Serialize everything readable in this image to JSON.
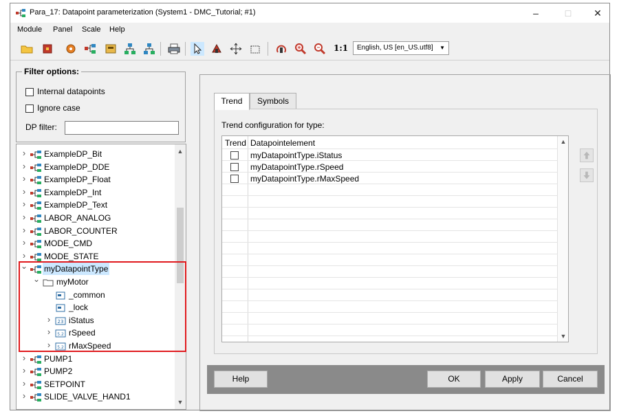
{
  "window": {
    "title": "Para_17: Datapoint parameterization (System1 - DMC_Tutorial; #1)",
    "controls": {
      "minimize": "–",
      "maximize": "□",
      "close": "✕"
    }
  },
  "menu": [
    "Module",
    "Panel",
    "Scale",
    "Help"
  ],
  "toolbar": {
    "icons": [
      "open-folder-icon",
      "stop-icon",
      "settings-icon",
      "datapoint-tree-icon",
      "archive-icon",
      "network-icon",
      "network-alt-icon",
      "print-icon",
      "pointer-icon",
      "zoom-pan-icon",
      "move-icon",
      "select-rect-icon",
      "rotate-icon",
      "zoom-in-icon",
      "zoom-out-icon"
    ],
    "scale_label": "1:1",
    "language": "English, US [en_US.utf8]"
  },
  "filter": {
    "legend": "Filter options:",
    "internal_datapoints": "Internal datapoints",
    "ignore_case": "Ignore case",
    "dp_filter_label": "DP filter:",
    "dp_filter_value": ""
  },
  "tree": {
    "items": [
      {
        "label": "ExampleDP_Bit",
        "level": 0,
        "expanded": false,
        "icon": "dpt-icon"
      },
      {
        "label": "ExampleDP_DDE",
        "level": 0,
        "expanded": false,
        "icon": "dpt-icon"
      },
      {
        "label": "ExampleDP_Float",
        "level": 0,
        "expanded": false,
        "icon": "dpt-icon"
      },
      {
        "label": "ExampleDP_Int",
        "level": 0,
        "expanded": false,
        "icon": "dpt-icon"
      },
      {
        "label": "ExampleDP_Text",
        "level": 0,
        "expanded": false,
        "icon": "dpt-icon"
      },
      {
        "label": "LABOR_ANALOG",
        "level": 0,
        "expanded": false,
        "icon": "dpt-icon"
      },
      {
        "label": "LABOR_COUNTER",
        "level": 0,
        "expanded": false,
        "icon": "dpt-icon"
      },
      {
        "label": "MODE_CMD",
        "level": 0,
        "expanded": false,
        "icon": "dpt-icon"
      },
      {
        "label": "MODE_STATE",
        "level": 0,
        "expanded": false,
        "icon": "dpt-icon"
      },
      {
        "label": "myDatapointType",
        "level": 0,
        "expanded": true,
        "icon": "dpt-icon",
        "selected": true
      },
      {
        "label": "myMotor",
        "level": 1,
        "expanded": true,
        "icon": "folder-icon"
      },
      {
        "label": "_common",
        "level": 2,
        "expanded": null,
        "icon": "config-icon"
      },
      {
        "label": "_lock",
        "level": 2,
        "expanded": null,
        "icon": "config-icon"
      },
      {
        "label": "iStatus",
        "level": 2,
        "expanded": false,
        "icon": "int-type-icon"
      },
      {
        "label": "rSpeed",
        "level": 2,
        "expanded": false,
        "icon": "float-type-icon"
      },
      {
        "label": "rMaxSpeed",
        "level": 2,
        "expanded": false,
        "icon": "float-type-icon"
      },
      {
        "label": "PUMP1",
        "level": 0,
        "expanded": false,
        "icon": "dpt-icon"
      },
      {
        "label": "PUMP2",
        "level": 0,
        "expanded": false,
        "icon": "dpt-icon"
      },
      {
        "label": "SETPOINT",
        "level": 0,
        "expanded": false,
        "icon": "dpt-icon"
      },
      {
        "label": "SLIDE_VALVE_HAND1",
        "level": 0,
        "expanded": false,
        "icon": "dpt-icon"
      }
    ],
    "type_badges": {
      "int": "23",
      "float": "5.2"
    }
  },
  "tabs": [
    {
      "label": "Trend",
      "active": true
    },
    {
      "label": "Symbols",
      "active": false
    }
  ],
  "trend": {
    "caption": "Trend configuration for type:",
    "columns": [
      "Trend",
      "Datapointelement"
    ],
    "rows": [
      {
        "checked": false,
        "element": "myDatapointType.iStatus"
      },
      {
        "checked": false,
        "element": "myDatapointType.rSpeed"
      },
      {
        "checked": false,
        "element": "myDatapointType.rMaxSpeed"
      }
    ]
  },
  "buttons": {
    "help": "Help",
    "ok": "OK",
    "apply": "Apply",
    "cancel": "Cancel"
  },
  "colors": {
    "selection": "#cce8ff",
    "highlight_frame": "#e0181c",
    "button_bar": "#8a8a8a"
  }
}
